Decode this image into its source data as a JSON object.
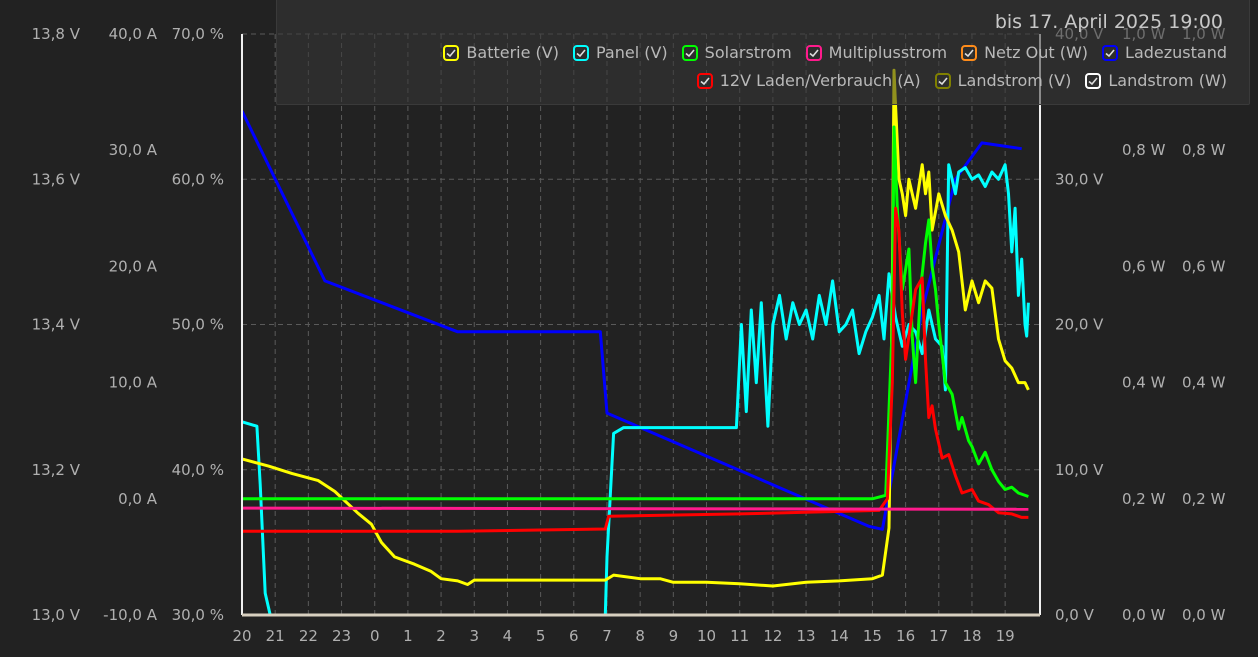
{
  "header": {
    "date_range": "bis 17. April 2025 19:00"
  },
  "legend": [
    {
      "label": "Batterie (V)",
      "color": "#ffff00",
      "icon": "checkbox-checked-icon"
    },
    {
      "label": "Panel (V)",
      "color": "#00ffff",
      "icon": "checkbox-checked-icon"
    },
    {
      "label": "Solarstrom",
      "color": "#00ff00",
      "icon": "checkbox-checked-icon"
    },
    {
      "label": "Multiplusstrom",
      "color": "#ff1a8c",
      "icon": "checkbox-checked-icon"
    },
    {
      "label": "Netz Out (W)",
      "color": "#ff8c1a",
      "icon": "checkbox-checked-icon"
    },
    {
      "label": "Ladezustand",
      "color": "#0000ff",
      "icon": "checkbox-checked-icon"
    },
    {
      "label": "12V Laden/Verbrauch (A)",
      "color": "#ff0000",
      "icon": "checkbox-checked-icon"
    },
    {
      "label": "Landstrom (V)",
      "color": "#808000",
      "icon": "checkbox-checked-icon"
    },
    {
      "label": "Landstrom (W)",
      "color": "#ffffff",
      "icon": "checkbox-checked-icon"
    }
  ],
  "chart_data": {
    "type": "line",
    "grid": true,
    "x_ticks": [
      "20",
      "21",
      "22",
      "23",
      "0",
      "1",
      "2",
      "3",
      "4",
      "5",
      "6",
      "7",
      "8",
      "9",
      "10",
      "11",
      "12",
      "13",
      "14",
      "15",
      "16",
      "17",
      "18",
      "19"
    ],
    "x_range_hours": [
      20,
      43.7
    ],
    "axes": {
      "battery_v": {
        "ticks": [
          "13,0 V",
          "13,2 V",
          "13,4 V",
          "13,6 V",
          "13,8 V"
        ],
        "range": [
          13.0,
          13.8
        ],
        "side": "left"
      },
      "current_a": {
        "ticks": [
          "-10,0 A",
          "0,0 A",
          "10,0 A",
          "20,0 A",
          "30,0 A",
          "40,0 A"
        ],
        "range": [
          -10,
          40
        ],
        "side": "left"
      },
      "soc_pct": {
        "ticks": [
          "30,0 %",
          "40,0 %",
          "50,0 %",
          "60,0 %",
          "70,0 %"
        ],
        "range": [
          30,
          70
        ],
        "side": "left"
      },
      "panel_v": {
        "ticks": [
          "0,0 V",
          "10,0 V",
          "20,0 V",
          "30,0 V",
          "40,0 V"
        ],
        "range": [
          0,
          40
        ],
        "side": "right"
      },
      "net_w": {
        "ticks": [
          "0,0 W",
          "0,2 W",
          "0,4 W",
          "0,6 W",
          "0,8 W",
          "1,0 W"
        ],
        "range": [
          0,
          1
        ],
        "side": "right"
      },
      "shore_w": {
        "ticks": [
          "0,0 W",
          "0,2 W",
          "0,4 W",
          "0,6 W",
          "0,8 W",
          "1,0 W"
        ],
        "range": [
          0,
          1
        ],
        "side": "right"
      }
    },
    "series": [
      {
        "name": "Ladezustand",
        "axis": "soc_pct",
        "color": "#0000ff",
        "points": [
          [
            20,
            64.7
          ],
          [
            22.5,
            53
          ],
          [
            26.5,
            49.5
          ],
          [
            30.8,
            49.5
          ],
          [
            31,
            43.9
          ],
          [
            38.9,
            36.1
          ],
          [
            39.3,
            35.9
          ],
          [
            40.5,
            51
          ],
          [
            41.5,
            60
          ],
          [
            42.3,
            62.5
          ],
          [
            43.5,
            62.1
          ]
        ]
      },
      {
        "name": "Panel (V)",
        "axis": "panel_v",
        "color": "#00ffff",
        "points": [
          [
            20,
            13.3
          ],
          [
            20.45,
            13
          ],
          [
            20.55,
            9
          ],
          [
            20.7,
            1.5
          ],
          [
            20.85,
            0
          ],
          [
            21,
            0
          ],
          [
            30.95,
            0
          ],
          [
            31,
            4
          ],
          [
            31.2,
            12.5
          ],
          [
            31.5,
            12.9
          ],
          [
            34.9,
            12.9
          ],
          [
            35.05,
            20
          ],
          [
            35.2,
            14
          ],
          [
            35.35,
            21
          ],
          [
            35.5,
            16
          ],
          [
            35.65,
            21.5
          ],
          [
            35.85,
            13
          ],
          [
            36,
            20
          ],
          [
            36.2,
            22
          ],
          [
            36.4,
            19
          ],
          [
            36.6,
            21.5
          ],
          [
            36.8,
            20
          ],
          [
            37,
            21
          ],
          [
            37.2,
            19
          ],
          [
            37.4,
            22
          ],
          [
            37.6,
            20
          ],
          [
            37.8,
            23
          ],
          [
            38,
            19.5
          ],
          [
            38.2,
            20
          ],
          [
            38.4,
            21
          ],
          [
            38.6,
            18
          ],
          [
            38.8,
            19.5
          ],
          [
            39,
            20.5
          ],
          [
            39.2,
            22
          ],
          [
            39.35,
            19
          ],
          [
            39.5,
            23.5
          ],
          [
            39.7,
            20.5
          ],
          [
            39.9,
            18.5
          ],
          [
            40.1,
            20
          ],
          [
            40.3,
            19.5
          ],
          [
            40.5,
            18
          ],
          [
            40.7,
            21
          ],
          [
            40.9,
            19
          ],
          [
            41.1,
            18.5
          ],
          [
            41.2,
            15.5
          ],
          [
            41.3,
            31
          ],
          [
            41.4,
            30
          ],
          [
            41.5,
            29
          ],
          [
            41.6,
            30.5
          ],
          [
            41.8,
            30.8
          ],
          [
            42,
            30
          ],
          [
            42.2,
            30.3
          ],
          [
            42.4,
            29.5
          ],
          [
            42.6,
            30.5
          ],
          [
            42.8,
            30
          ],
          [
            43,
            31
          ],
          [
            43.1,
            29
          ],
          [
            43.2,
            25
          ],
          [
            43.3,
            28
          ],
          [
            43.4,
            22
          ],
          [
            43.5,
            24.5
          ],
          [
            43.6,
            20
          ],
          [
            43.65,
            19.2
          ],
          [
            43.7,
            21.5
          ]
        ]
      },
      {
        "name": "Batterie (V)",
        "axis": "battery_v",
        "color": "#ffff00",
        "points": [
          [
            20,
            13.215
          ],
          [
            20.8,
            13.205
          ],
          [
            21.5,
            13.195
          ],
          [
            22.3,
            13.185
          ],
          [
            22.8,
            13.17
          ],
          [
            23.5,
            13.14
          ],
          [
            23.9,
            13.125
          ],
          [
            24.2,
            13.1
          ],
          [
            24.6,
            13.08
          ],
          [
            25.2,
            13.07
          ],
          [
            25.7,
            13.06
          ],
          [
            26,
            13.05
          ],
          [
            26.5,
            13.047
          ],
          [
            26.8,
            13.042
          ],
          [
            27,
            13.048
          ],
          [
            30.95,
            13.048
          ],
          [
            31.2,
            13.055
          ],
          [
            32,
            13.05
          ],
          [
            32.6,
            13.05
          ],
          [
            33,
            13.045
          ],
          [
            34,
            13.045
          ],
          [
            35,
            13.043
          ],
          [
            36,
            13.04
          ],
          [
            37,
            13.045
          ],
          [
            38,
            13.047
          ],
          [
            39,
            13.05
          ],
          [
            39.3,
            13.055
          ],
          [
            39.5,
            13.12
          ],
          [
            39.6,
            13.45
          ],
          [
            39.65,
            13.75
          ],
          [
            39.7,
            13.7
          ],
          [
            39.8,
            13.6
          ],
          [
            39.9,
            13.58
          ],
          [
            40,
            13.55
          ],
          [
            40.1,
            13.6
          ],
          [
            40.3,
            13.56
          ],
          [
            40.5,
            13.62
          ],
          [
            40.6,
            13.58
          ],
          [
            40.7,
            13.61
          ],
          [
            40.8,
            13.53
          ],
          [
            41,
            13.58
          ],
          [
            41.2,
            13.55
          ],
          [
            41.4,
            13.53
          ],
          [
            41.6,
            13.5
          ],
          [
            41.8,
            13.42
          ],
          [
            42,
            13.46
          ],
          [
            42.2,
            13.43
          ],
          [
            42.4,
            13.46
          ],
          [
            42.6,
            13.45
          ],
          [
            42.8,
            13.38
          ],
          [
            43,
            13.35
          ],
          [
            43.2,
            13.34
          ],
          [
            43.4,
            13.32
          ],
          [
            43.6,
            13.32
          ],
          [
            43.7,
            13.31
          ]
        ]
      },
      {
        "name": "Solarstrom",
        "axis": "current_a",
        "color": "#00ff00",
        "points": [
          [
            20,
            0
          ],
          [
            39,
            0
          ],
          [
            39.4,
            0.3
          ],
          [
            39.6,
            15
          ],
          [
            39.65,
            32
          ],
          [
            39.75,
            25
          ],
          [
            39.9,
            18
          ],
          [
            40.1,
            21.5
          ],
          [
            40.2,
            14
          ],
          [
            40.3,
            10
          ],
          [
            40.45,
            18
          ],
          [
            40.6,
            22
          ],
          [
            40.7,
            24
          ],
          [
            40.8,
            20
          ],
          [
            40.9,
            18
          ],
          [
            41,
            15
          ],
          [
            41.2,
            10
          ],
          [
            41.4,
            9
          ],
          [
            41.6,
            6
          ],
          [
            41.7,
            7
          ],
          [
            41.9,
            5
          ],
          [
            42,
            4.5
          ],
          [
            42.2,
            3
          ],
          [
            42.4,
            4
          ],
          [
            42.6,
            2.5
          ],
          [
            42.8,
            1.5
          ],
          [
            43,
            0.8
          ],
          [
            43.2,
            1
          ],
          [
            43.4,
            0.5
          ],
          [
            43.7,
            0.2
          ]
        ]
      },
      {
        "name": "12V Laden/Verbrauch (A)",
        "axis": "current_a",
        "color": "#ff0000",
        "points": [
          [
            20,
            -2.8
          ],
          [
            26.5,
            -2.8
          ],
          [
            30.95,
            -2.6
          ],
          [
            31.05,
            -1.5
          ],
          [
            35,
            -1.3
          ],
          [
            39.2,
            -1
          ],
          [
            39.45,
            0
          ],
          [
            39.6,
            10
          ],
          [
            39.7,
            25
          ],
          [
            39.8,
            23
          ],
          [
            39.9,
            16
          ],
          [
            40,
            12
          ],
          [
            40.15,
            15
          ],
          [
            40.3,
            18
          ],
          [
            40.5,
            19
          ],
          [
            40.6,
            12
          ],
          [
            40.7,
            7
          ],
          [
            40.8,
            8
          ],
          [
            40.9,
            6
          ],
          [
            41.1,
            3.5
          ],
          [
            41.3,
            3.8
          ],
          [
            41.5,
            2
          ],
          [
            41.7,
            0.5
          ],
          [
            42,
            0.8
          ],
          [
            42.2,
            -0.2
          ],
          [
            42.5,
            -0.5
          ],
          [
            42.8,
            -1.2
          ],
          [
            43.2,
            -1.3
          ],
          [
            43.5,
            -1.6
          ],
          [
            43.7,
            -1.6
          ]
        ]
      },
      {
        "name": "Multiplusstrom",
        "axis": "current_a",
        "color": "#ff1a8c",
        "points": [
          [
            20,
            -0.8
          ],
          [
            43.7,
            -0.9
          ]
        ]
      }
    ]
  }
}
